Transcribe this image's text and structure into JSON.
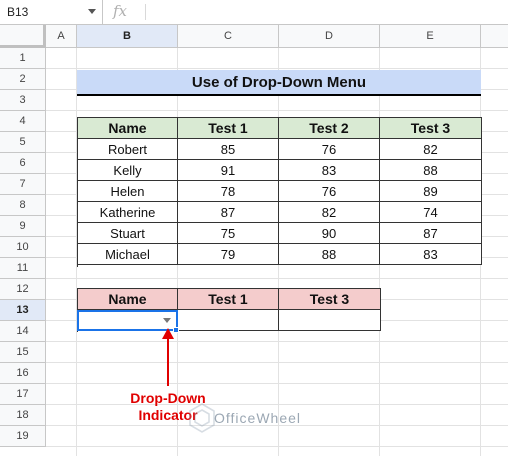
{
  "formula_bar": {
    "name_box": "B13",
    "fx_label": "fx",
    "formula": ""
  },
  "columns": [
    "A",
    "B",
    "C",
    "D",
    "E"
  ],
  "rows": [
    "1",
    "2",
    "3",
    "4",
    "5",
    "6",
    "7",
    "8",
    "9",
    "10",
    "11",
    "12",
    "13",
    "14",
    "15",
    "16",
    "17",
    "18",
    "19"
  ],
  "selected_column": "B",
  "selected_row": "13",
  "title": "Use of Drop-Down Menu",
  "table1": {
    "headers": [
      "Name",
      "Test 1",
      "Test 2",
      "Test 3"
    ],
    "rows": [
      [
        "Robert",
        "85",
        "76",
        "82"
      ],
      [
        "Kelly",
        "91",
        "83",
        "88"
      ],
      [
        "Helen",
        "78",
        "76",
        "89"
      ],
      [
        "Katherine",
        "87",
        "82",
        "74"
      ],
      [
        "Stuart",
        "75",
        "90",
        "87"
      ],
      [
        "Michael",
        "79",
        "88",
        "83"
      ]
    ]
  },
  "table2": {
    "headers": [
      "Name",
      "Test 1",
      "Test 3"
    ],
    "row": [
      "",
      "",
      ""
    ]
  },
  "annotation": {
    "line1": "Drop-Down",
    "line2": "Indicator"
  },
  "watermark": "OfficeWheel",
  "colors": {
    "title_bg": "#c9daf8",
    "table1_header_bg": "#d9ead3",
    "table2_header_bg": "#f4cccc",
    "selection": "#1a73e8",
    "annotation": "#e00000"
  }
}
